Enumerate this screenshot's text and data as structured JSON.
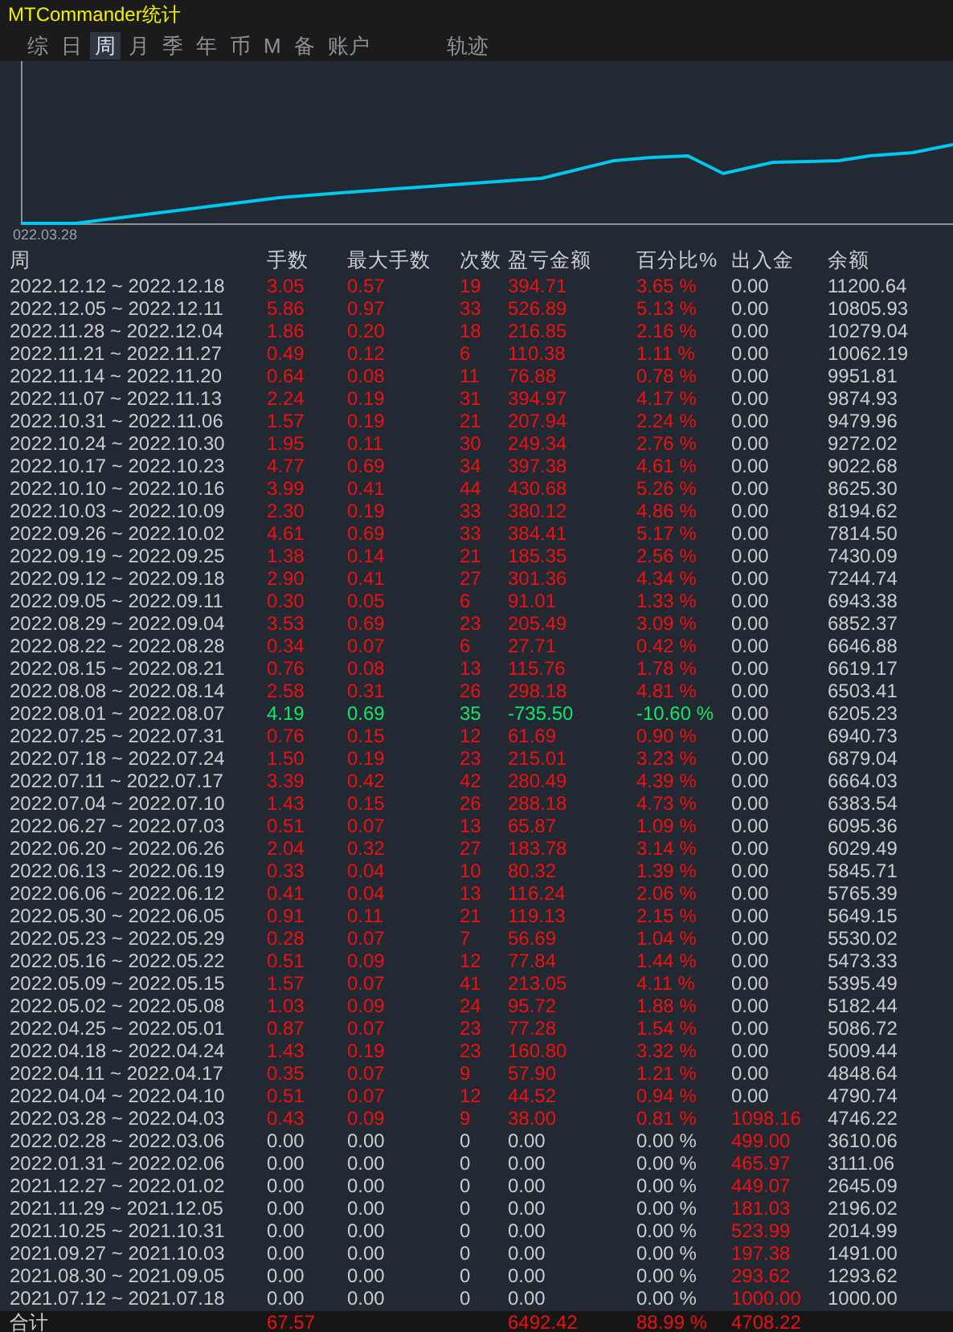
{
  "window": {
    "title": "MTCommander统计"
  },
  "tabs": [
    {
      "label": "综",
      "selected": false
    },
    {
      "label": "日",
      "selected": false
    },
    {
      "label": "周",
      "selected": true
    },
    {
      "label": "月",
      "selected": false
    },
    {
      "label": "季",
      "selected": false
    },
    {
      "label": "年",
      "selected": false
    },
    {
      "label": "币",
      "selected": false
    },
    {
      "label": "M",
      "selected": false
    },
    {
      "label": "备",
      "selected": false
    },
    {
      "label": "账户",
      "selected": false
    },
    {
      "label": "轨迹",
      "selected": false
    }
  ],
  "chart": {
    "x_label": "022.03.28"
  },
  "table": {
    "columns": [
      "周",
      "手数",
      "最大手数",
      "次数",
      "盈亏金额",
      "百分比%",
      "出入金",
      "余额"
    ],
    "rows": [
      {
        "week": "2022.12.12 ~ 2022.12.18",
        "lots": "3.05",
        "max_lots": "0.57",
        "trades": "19",
        "pnl": "394.71",
        "percent": "3.65 %",
        "deposit": "0.00",
        "balance": "11200.64",
        "kind": "profit",
        "deposit_marked": false
      },
      {
        "week": "2022.12.05 ~ 2022.12.11",
        "lots": "5.86",
        "max_lots": "0.97",
        "trades": "33",
        "pnl": "526.89",
        "percent": "5.13 %",
        "deposit": "0.00",
        "balance": "10805.93",
        "kind": "profit",
        "deposit_marked": false
      },
      {
        "week": "2022.11.28 ~ 2022.12.04",
        "lots": "1.86",
        "max_lots": "0.20",
        "trades": "18",
        "pnl": "216.85",
        "percent": "2.16 %",
        "deposit": "0.00",
        "balance": "10279.04",
        "kind": "profit",
        "deposit_marked": false
      },
      {
        "week": "2022.11.21 ~ 2022.11.27",
        "lots": "0.49",
        "max_lots": "0.12",
        "trades": "6",
        "pnl": "110.38",
        "percent": "1.11 %",
        "deposit": "0.00",
        "balance": "10062.19",
        "kind": "profit",
        "deposit_marked": false
      },
      {
        "week": "2022.11.14 ~ 2022.11.20",
        "lots": "0.64",
        "max_lots": "0.08",
        "trades": "11",
        "pnl": "76.88",
        "percent": "0.78 %",
        "deposit": "0.00",
        "balance": "9951.81",
        "kind": "profit",
        "deposit_marked": false
      },
      {
        "week": "2022.11.07 ~ 2022.11.13",
        "lots": "2.24",
        "max_lots": "0.19",
        "trades": "31",
        "pnl": "394.97",
        "percent": "4.17 %",
        "deposit": "0.00",
        "balance": "9874.93",
        "kind": "profit",
        "deposit_marked": false
      },
      {
        "week": "2022.10.31 ~ 2022.11.06",
        "lots": "1.57",
        "max_lots": "0.19",
        "trades": "21",
        "pnl": "207.94",
        "percent": "2.24 %",
        "deposit": "0.00",
        "balance": "9479.96",
        "kind": "profit",
        "deposit_marked": false
      },
      {
        "week": "2022.10.24 ~ 2022.10.30",
        "lots": "1.95",
        "max_lots": "0.11",
        "trades": "30",
        "pnl": "249.34",
        "percent": "2.76 %",
        "deposit": "0.00",
        "balance": "9272.02",
        "kind": "profit",
        "deposit_marked": false
      },
      {
        "week": "2022.10.17 ~ 2022.10.23",
        "lots": "4.77",
        "max_lots": "0.69",
        "trades": "34",
        "pnl": "397.38",
        "percent": "4.61 %",
        "deposit": "0.00",
        "balance": "9022.68",
        "kind": "profit",
        "deposit_marked": false
      },
      {
        "week": "2022.10.10 ~ 2022.10.16",
        "lots": "3.99",
        "max_lots": "0.41",
        "trades": "44",
        "pnl": "430.68",
        "percent": "5.26 %",
        "deposit": "0.00",
        "balance": "8625.30",
        "kind": "profit",
        "deposit_marked": false
      },
      {
        "week": "2022.10.03 ~ 2022.10.09",
        "lots": "2.30",
        "max_lots": "0.19",
        "trades": "33",
        "pnl": "380.12",
        "percent": "4.86 %",
        "deposit": "0.00",
        "balance": "8194.62",
        "kind": "profit",
        "deposit_marked": false
      },
      {
        "week": "2022.09.26 ~ 2022.10.02",
        "lots": "4.61",
        "max_lots": "0.69",
        "trades": "33",
        "pnl": "384.41",
        "percent": "5.17 %",
        "deposit": "0.00",
        "balance": "7814.50",
        "kind": "profit",
        "deposit_marked": false
      },
      {
        "week": "2022.09.19 ~ 2022.09.25",
        "lots": "1.38",
        "max_lots": "0.14",
        "trades": "21",
        "pnl": "185.35",
        "percent": "2.56 %",
        "deposit": "0.00",
        "balance": "7430.09",
        "kind": "profit",
        "deposit_marked": false
      },
      {
        "week": "2022.09.12 ~ 2022.09.18",
        "lots": "2.90",
        "max_lots": "0.41",
        "trades": "27",
        "pnl": "301.36",
        "percent": "4.34 %",
        "deposit": "0.00",
        "balance": "7244.74",
        "kind": "profit",
        "deposit_marked": false
      },
      {
        "week": "2022.09.05 ~ 2022.09.11",
        "lots": "0.30",
        "max_lots": "0.05",
        "trades": "6",
        "pnl": "91.01",
        "percent": "1.33 %",
        "deposit": "0.00",
        "balance": "6943.38",
        "kind": "profit",
        "deposit_marked": false
      },
      {
        "week": "2022.08.29 ~ 2022.09.04",
        "lots": "3.53",
        "max_lots": "0.69",
        "trades": "23",
        "pnl": "205.49",
        "percent": "3.09 %",
        "deposit": "0.00",
        "balance": "6852.37",
        "kind": "profit",
        "deposit_marked": false
      },
      {
        "week": "2022.08.22 ~ 2022.08.28",
        "lots": "0.34",
        "max_lots": "0.07",
        "trades": "6",
        "pnl": "27.71",
        "percent": "0.42 %",
        "deposit": "0.00",
        "balance": "6646.88",
        "kind": "profit",
        "deposit_marked": false
      },
      {
        "week": "2022.08.15 ~ 2022.08.21",
        "lots": "0.76",
        "max_lots": "0.08",
        "trades": "13",
        "pnl": "115.76",
        "percent": "1.78 %",
        "deposit": "0.00",
        "balance": "6619.17",
        "kind": "profit",
        "deposit_marked": false
      },
      {
        "week": "2022.08.08 ~ 2022.08.14",
        "lots": "2.58",
        "max_lots": "0.31",
        "trades": "26",
        "pnl": "298.18",
        "percent": "4.81 %",
        "deposit": "0.00",
        "balance": "6503.41",
        "kind": "profit",
        "deposit_marked": false
      },
      {
        "week": "2022.08.01 ~ 2022.08.07",
        "lots": "4.19",
        "max_lots": "0.69",
        "trades": "35",
        "pnl": "-735.50",
        "percent": "-10.60 %",
        "deposit": "0.00",
        "balance": "6205.23",
        "kind": "loss",
        "deposit_marked": false
      },
      {
        "week": "2022.07.25 ~ 2022.07.31",
        "lots": "0.76",
        "max_lots": "0.15",
        "trades": "12",
        "pnl": "61.69",
        "percent": "0.90 %",
        "deposit": "0.00",
        "balance": "6940.73",
        "kind": "profit",
        "deposit_marked": false
      },
      {
        "week": "2022.07.18 ~ 2022.07.24",
        "lots": "1.50",
        "max_lots": "0.19",
        "trades": "23",
        "pnl": "215.01",
        "percent": "3.23 %",
        "deposit": "0.00",
        "balance": "6879.04",
        "kind": "profit",
        "deposit_marked": false
      },
      {
        "week": "2022.07.11 ~ 2022.07.17",
        "lots": "3.39",
        "max_lots": "0.42",
        "trades": "42",
        "pnl": "280.49",
        "percent": "4.39 %",
        "deposit": "0.00",
        "balance": "6664.03",
        "kind": "profit",
        "deposit_marked": false
      },
      {
        "week": "2022.07.04 ~ 2022.07.10",
        "lots": "1.43",
        "max_lots": "0.15",
        "trades": "26",
        "pnl": "288.18",
        "percent": "4.73 %",
        "deposit": "0.00",
        "balance": "6383.54",
        "kind": "profit",
        "deposit_marked": false
      },
      {
        "week": "2022.06.27 ~ 2022.07.03",
        "lots": "0.51",
        "max_lots": "0.07",
        "trades": "13",
        "pnl": "65.87",
        "percent": "1.09 %",
        "deposit": "0.00",
        "balance": "6095.36",
        "kind": "profit",
        "deposit_marked": false
      },
      {
        "week": "2022.06.20 ~ 2022.06.26",
        "lots": "2.04",
        "max_lots": "0.32",
        "trades": "27",
        "pnl": "183.78",
        "percent": "3.14 %",
        "deposit": "0.00",
        "balance": "6029.49",
        "kind": "profit",
        "deposit_marked": false
      },
      {
        "week": "2022.06.13 ~ 2022.06.19",
        "lots": "0.33",
        "max_lots": "0.04",
        "trades": "10",
        "pnl": "80.32",
        "percent": "1.39 %",
        "deposit": "0.00",
        "balance": "5845.71",
        "kind": "profit",
        "deposit_marked": false
      },
      {
        "week": "2022.06.06 ~ 2022.06.12",
        "lots": "0.41",
        "max_lots": "0.04",
        "trades": "13",
        "pnl": "116.24",
        "percent": "2.06 %",
        "deposit": "0.00",
        "balance": "5765.39",
        "kind": "profit",
        "deposit_marked": false
      },
      {
        "week": "2022.05.30 ~ 2022.06.05",
        "lots": "0.91",
        "max_lots": "0.11",
        "trades": "21",
        "pnl": "119.13",
        "percent": "2.15 %",
        "deposit": "0.00",
        "balance": "5649.15",
        "kind": "profit",
        "deposit_marked": false
      },
      {
        "week": "2022.05.23 ~ 2022.05.29",
        "lots": "0.28",
        "max_lots": "0.07",
        "trades": "7",
        "pnl": "56.69",
        "percent": "1.04 %",
        "deposit": "0.00",
        "balance": "5530.02",
        "kind": "profit",
        "deposit_marked": false
      },
      {
        "week": "2022.05.16 ~ 2022.05.22",
        "lots": "0.51",
        "max_lots": "0.09",
        "trades": "12",
        "pnl": "77.84",
        "percent": "1.44 %",
        "deposit": "0.00",
        "balance": "5473.33",
        "kind": "profit",
        "deposit_marked": false
      },
      {
        "week": "2022.05.09 ~ 2022.05.15",
        "lots": "1.57",
        "max_lots": "0.07",
        "trades": "41",
        "pnl": "213.05",
        "percent": "4.11 %",
        "deposit": "0.00",
        "balance": "5395.49",
        "kind": "profit",
        "deposit_marked": false
      },
      {
        "week": "2022.05.02 ~ 2022.05.08",
        "lots": "1.03",
        "max_lots": "0.09",
        "trades": "24",
        "pnl": "95.72",
        "percent": "1.88 %",
        "deposit": "0.00",
        "balance": "5182.44",
        "kind": "profit",
        "deposit_marked": false
      },
      {
        "week": "2022.04.25 ~ 2022.05.01",
        "lots": "0.87",
        "max_lots": "0.07",
        "trades": "23",
        "pnl": "77.28",
        "percent": "1.54 %",
        "deposit": "0.00",
        "balance": "5086.72",
        "kind": "profit",
        "deposit_marked": false
      },
      {
        "week": "2022.04.18 ~ 2022.04.24",
        "lots": "1.43",
        "max_lots": "0.19",
        "trades": "23",
        "pnl": "160.80",
        "percent": "3.32 %",
        "deposit": "0.00",
        "balance": "5009.44",
        "kind": "profit",
        "deposit_marked": false
      },
      {
        "week": "2022.04.11 ~ 2022.04.17",
        "lots": "0.35",
        "max_lots": "0.07",
        "trades": "9",
        "pnl": "57.90",
        "percent": "1.21 %",
        "deposit": "0.00",
        "balance": "4848.64",
        "kind": "profit",
        "deposit_marked": false
      },
      {
        "week": "2022.04.04 ~ 2022.04.10",
        "lots": "0.51",
        "max_lots": "0.07",
        "trades": "12",
        "pnl": "44.52",
        "percent": "0.94 %",
        "deposit": "0.00",
        "balance": "4790.74",
        "kind": "profit",
        "deposit_marked": false
      },
      {
        "week": "2022.03.28 ~ 2022.04.03",
        "lots": "0.43",
        "max_lots": "0.09",
        "trades": "9",
        "pnl": "38.00",
        "percent": "0.81 %",
        "deposit": "1098.16",
        "balance": "4746.22",
        "kind": "profit",
        "deposit_marked": true
      },
      {
        "week": "2022.02.28 ~ 2022.03.06",
        "lots": "0.00",
        "max_lots": "0.00",
        "trades": "0",
        "pnl": "0.00",
        "percent": "0.00 %",
        "deposit": "499.00",
        "balance": "3610.06",
        "kind": "flat",
        "deposit_marked": true
      },
      {
        "week": "2022.01.31 ~ 2022.02.06",
        "lots": "0.00",
        "max_lots": "0.00",
        "trades": "0",
        "pnl": "0.00",
        "percent": "0.00 %",
        "deposit": "465.97",
        "balance": "3111.06",
        "kind": "flat",
        "deposit_marked": true
      },
      {
        "week": "2021.12.27 ~ 2022.01.02",
        "lots": "0.00",
        "max_lots": "0.00",
        "trades": "0",
        "pnl": "0.00",
        "percent": "0.00 %",
        "deposit": "449.07",
        "balance": "2645.09",
        "kind": "flat",
        "deposit_marked": true
      },
      {
        "week": "2021.11.29 ~ 2021.12.05",
        "lots": "0.00",
        "max_lots": "0.00",
        "trades": "0",
        "pnl": "0.00",
        "percent": "0.00 %",
        "deposit": "181.03",
        "balance": "2196.02",
        "kind": "flat",
        "deposit_marked": true
      },
      {
        "week": "2021.10.25 ~ 2021.10.31",
        "lots": "0.00",
        "max_lots": "0.00",
        "trades": "0",
        "pnl": "0.00",
        "percent": "0.00 %",
        "deposit": "523.99",
        "balance": "2014.99",
        "kind": "flat",
        "deposit_marked": true
      },
      {
        "week": "2021.09.27 ~ 2021.10.03",
        "lots": "0.00",
        "max_lots": "0.00",
        "trades": "0",
        "pnl": "0.00",
        "percent": "0.00 %",
        "deposit": "197.38",
        "balance": "1491.00",
        "kind": "flat",
        "deposit_marked": true
      },
      {
        "week": "2021.08.30 ~ 2021.09.05",
        "lots": "0.00",
        "max_lots": "0.00",
        "trades": "0",
        "pnl": "0.00",
        "percent": "0.00 %",
        "deposit": "293.62",
        "balance": "1293.62",
        "kind": "flat",
        "deposit_marked": true
      },
      {
        "week": "2021.07.12 ~ 2021.07.18",
        "lots": "0.00",
        "max_lots": "0.00",
        "trades": "0",
        "pnl": "0.00",
        "percent": "0.00 %",
        "deposit": "1000.00",
        "balance": "1000.00",
        "kind": "flat",
        "deposit_marked": true
      }
    ],
    "total": {
      "label": "合计",
      "lots": "67.57",
      "pnl": "6492.42",
      "percent": "88.99 %",
      "deposit": "4708.22"
    }
  }
}
